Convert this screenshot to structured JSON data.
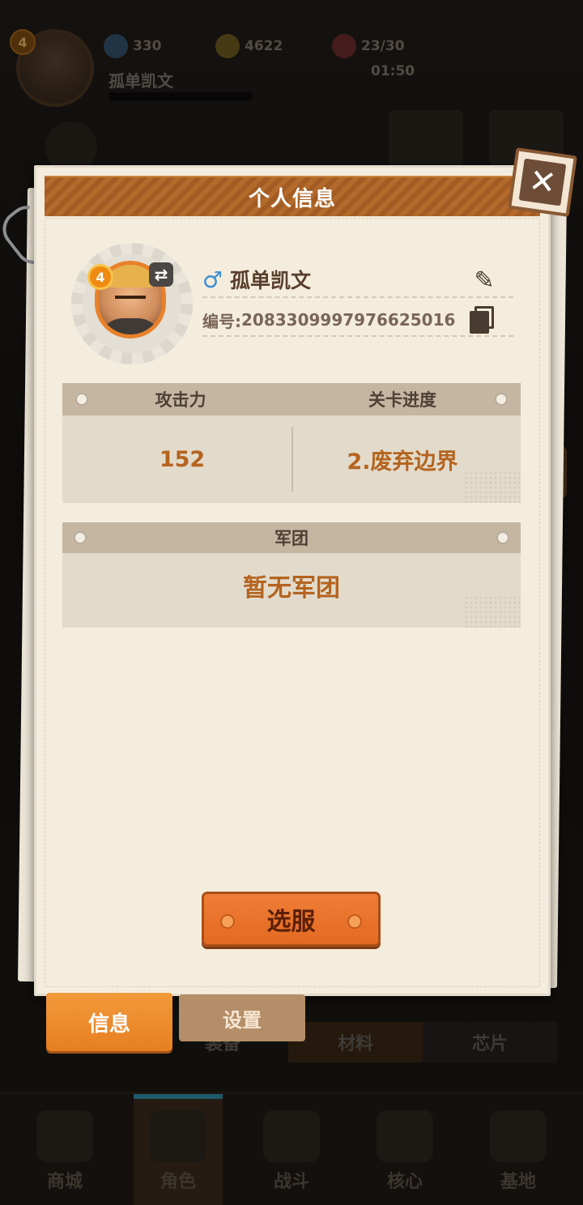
{
  "hud": {
    "level": "4",
    "gems": "330",
    "coins": "4622",
    "stamina": "23/30",
    "timer": "01:50",
    "player_name": "孤单凯文"
  },
  "bottom_tabs": {
    "info": "信息",
    "settings": "设置",
    "equipment": "装备",
    "materials": "材料",
    "chips": "芯片"
  },
  "nav": [
    {
      "label": "商城",
      "icon": "shop-icon"
    },
    {
      "label": "角色",
      "icon": "character-icon"
    },
    {
      "label": "战斗",
      "icon": "battle-icon"
    },
    {
      "label": "核心",
      "icon": "core-icon"
    },
    {
      "label": "基地",
      "icon": "base-icon"
    }
  ],
  "modal": {
    "title": "个人信息",
    "level": "4",
    "gender_symbol": "♂",
    "name": "孤单凯文",
    "id_label": "编号:",
    "id_value": "2083309997976625016",
    "stats": {
      "attack_label": "攻击力",
      "attack_value": "152",
      "progress_label": "关卡进度",
      "progress_value": "2.废弃边界"
    },
    "guild": {
      "label": "军团",
      "value": "暂无军团"
    },
    "server_button": "选服"
  },
  "colors": {
    "accent_orange": "#e77f21",
    "header_brown": "#a35c23",
    "value_orange": "#b4641f",
    "male_blue": "#3d8fd4"
  }
}
